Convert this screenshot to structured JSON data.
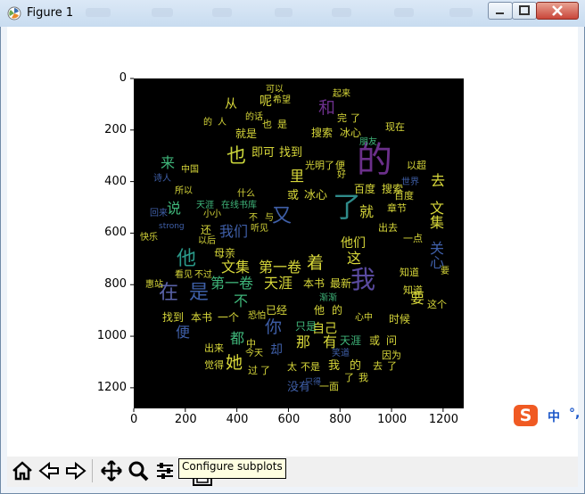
{
  "window": {
    "title": "Figure 1"
  },
  "axes": {
    "y_ticks": [
      "0",
      "200",
      "400",
      "600",
      "800",
      "1000",
      "1200"
    ],
    "x_ticks": [
      "0",
      "200",
      "400",
      "600",
      "800",
      "1000",
      "1200"
    ]
  },
  "toolbar": {
    "tooltip": "Configure subplots"
  },
  "ime": {
    "logo": "S",
    "mode": "中"
  },
  "wordcloud": [
    {
      "t": "的",
      "x": 400,
      "y": 160,
      "s": 40,
      "c": "#6b2f8a"
    },
    {
      "t": "了",
      "x": 373,
      "y": 216,
      "s": 32,
      "c": "#2f8b8a"
    },
    {
      "t": "我",
      "x": 393,
      "y": 300,
      "s": 28,
      "c": "#5a4aa0"
    },
    {
      "t": "也",
      "x": 254,
      "y": 165,
      "s": 22,
      "c": "#c9d43a"
    },
    {
      "t": "又",
      "x": 305,
      "y": 232,
      "s": 22,
      "c": "#3f5fa8"
    },
    {
      "t": "他",
      "x": 198,
      "y": 280,
      "s": 22,
      "c": "#2a9a8a"
    },
    {
      "t": "在",
      "x": 178,
      "y": 318,
      "s": 22,
      "c": "#5a62a8"
    },
    {
      "t": "是",
      "x": 212,
      "y": 318,
      "s": 22,
      "c": "#3e5fa6"
    },
    {
      "t": "着",
      "x": 344,
      "y": 286,
      "s": 19,
      "c": "#d8d83a"
    },
    {
      "t": "你",
      "x": 297,
      "y": 358,
      "s": 19,
      "c": "#3f5fa8"
    },
    {
      "t": "她",
      "x": 253,
      "y": 398,
      "s": 19,
      "c": "#d8d83a"
    },
    {
      "t": "和",
      "x": 357,
      "y": 112,
      "s": 19,
      "c": "#6b2f8a"
    },
    {
      "t": "来",
      "x": 180,
      "y": 175,
      "s": 16,
      "c": "#3fb67a"
    },
    {
      "t": "说",
      "x": 187,
      "y": 226,
      "s": 16,
      "c": "#3fb67a"
    },
    {
      "t": "就",
      "x": 403,
      "y": 230,
      "s": 16,
      "c": "#d8d83a"
    },
    {
      "t": "去",
      "x": 483,
      "y": 195,
      "s": 16,
      "c": "#d8d83a"
    },
    {
      "t": "这",
      "x": 389,
      "y": 282,
      "s": 16,
      "c": "#d8d83a"
    },
    {
      "t": "便",
      "x": 197,
      "y": 365,
      "s": 16,
      "c": "#3f5fa8"
    },
    {
      "t": "有",
      "x": 362,
      "y": 376,
      "s": 16,
      "c": "#d8d83a"
    },
    {
      "t": "那",
      "x": 332,
      "y": 376,
      "s": 16,
      "c": "#d8d83a"
    },
    {
      "t": "都",
      "x": 258,
      "y": 372,
      "s": 16,
      "c": "#3fb67a"
    },
    {
      "t": "里",
      "x": 325,
      "y": 190,
      "s": 16,
      "c": "#d8d83a"
    },
    {
      "t": "不",
      "x": 262,
      "y": 330,
      "s": 16,
      "c": "#3fb67a"
    },
    {
      "t": "要",
      "x": 460,
      "y": 327,
      "s": 16,
      "c": "#d8d83a"
    },
    {
      "t": "却",
      "x": 303,
      "y": 386,
      "s": 14,
      "c": "#3f5fa8"
    },
    {
      "t": "从",
      "x": 252,
      "y": 110,
      "s": 14,
      "c": "#d8d83a"
    },
    {
      "t": "呢",
      "x": 291,
      "y": 107,
      "s": 14,
      "c": "#d8d83a"
    },
    {
      "t": "文集",
      "x": 248,
      "y": 292,
      "s": 16,
      "c": "#d8d83a"
    },
    {
      "t": "第一卷",
      "x": 290,
      "y": 292,
      "s": 16,
      "c": "#d8d83a"
    },
    {
      "t": "第一卷",
      "x": 236,
      "y": 310,
      "s": 16,
      "c": "#3fb67a"
    },
    {
      "t": "天涯",
      "x": 296,
      "y": 310,
      "s": 16,
      "c": "#d8d83a"
    },
    {
      "t": "我们",
      "x": 246,
      "y": 252,
      "s": 16,
      "c": "#3f5fa8"
    },
    {
      "t": "他们",
      "x": 382,
      "y": 266,
      "s": 14,
      "c": "#d8d83a"
    },
    {
      "t": "关心",
      "x": 480,
      "y": 270,
      "s": 16,
      "c": "#3f5fa8",
      "v": 1
    },
    {
      "t": "文集",
      "x": 480,
      "y": 225,
      "s": 16,
      "c": "#d8d83a",
      "v": 1
    },
    {
      "t": "自己",
      "x": 350,
      "y": 362,
      "s": 14,
      "c": "#d8d83a"
    },
    {
      "t": "即可",
      "x": 282,
      "y": 165,
      "s": 13,
      "c": "#d8d83a"
    },
    {
      "t": "找到",
      "x": 313,
      "y": 165,
      "s": 13,
      "c": "#d8d83a"
    },
    {
      "t": "或",
      "x": 322,
      "y": 213,
      "s": 13,
      "c": "#d8d83a"
    },
    {
      "t": "冰心",
      "x": 341,
      "y": 213,
      "s": 13,
      "c": "#d8d83a"
    },
    {
      "t": "百度",
      "x": 397,
      "y": 206,
      "s": 12,
      "c": "#d8d83a"
    },
    {
      "t": "搜索",
      "x": 428,
      "y": 206,
      "s": 12,
      "c": "#d8d83a"
    },
    {
      "t": "搜索",
      "x": 349,
      "y": 143,
      "s": 12,
      "c": "#d8d83a"
    },
    {
      "t": "冰心",
      "x": 381,
      "y": 143,
      "s": 12,
      "c": "#d8d83a"
    },
    {
      "t": "本书",
      "x": 340,
      "y": 312,
      "s": 12,
      "c": "#d8d83a"
    },
    {
      "t": "最新",
      "x": 370,
      "y": 312,
      "s": 12,
      "c": "#d8d83a"
    },
    {
      "t": "找到",
      "x": 182,
      "y": 350,
      "s": 12,
      "c": "#d8d83a"
    },
    {
      "t": "本书",
      "x": 214,
      "y": 350,
      "s": 12,
      "c": "#d8d83a"
    },
    {
      "t": "一个",
      "x": 244,
      "y": 350,
      "s": 12,
      "c": "#d8d83a"
    },
    {
      "t": "母亲",
      "x": 240,
      "y": 278,
      "s": 12,
      "c": "#d8d83a"
    },
    {
      "t": "已经",
      "x": 298,
      "y": 342,
      "s": 12,
      "c": "#d8d83a"
    },
    {
      "t": "只是",
      "x": 331,
      "y": 360,
      "s": 12,
      "c": "#3fb67a"
    },
    {
      "t": "他",
      "x": 352,
      "y": 342,
      "s": 12,
      "c": "#d8d83a"
    },
    {
      "t": "的",
      "x": 372,
      "y": 342,
      "s": 12,
      "c": "#d8d83a"
    },
    {
      "t": "时候",
      "x": 436,
      "y": 352,
      "s": 12,
      "c": "#d8d83a"
    },
    {
      "t": "天涯",
      "x": 381,
      "y": 376,
      "s": 12,
      "c": "#3fb67a"
    },
    {
      "t": "或",
      "x": 414,
      "y": 376,
      "s": 12,
      "c": "#d8d83a"
    },
    {
      "t": "问",
      "x": 433,
      "y": 376,
      "s": 12,
      "c": "#d8d83a"
    },
    {
      "t": "我",
      "x": 368,
      "y": 404,
      "s": 13,
      "c": "#d8d83a"
    },
    {
      "t": "的",
      "x": 392,
      "y": 404,
      "s": 13,
      "c": "#d8d83a"
    },
    {
      "t": "出来",
      "x": 229,
      "y": 385,
      "s": 11,
      "c": "#d8d83a"
    },
    {
      "t": "觉得",
      "x": 229,
      "y": 404,
      "s": 11,
      "c": "#d8d83a"
    },
    {
      "t": "中",
      "x": 276,
      "y": 380,
      "s": 11,
      "c": "#d8d83a"
    },
    {
      "t": "没有",
      "x": 322,
      "y": 428,
      "s": 13,
      "c": "#3f5fa8"
    },
    {
      "t": "一面",
      "x": 358,
      "y": 428,
      "s": 11,
      "c": "#d8d83a"
    },
    {
      "t": "了",
      "x": 386,
      "y": 418,
      "s": 11,
      "c": "#d8d83a"
    },
    {
      "t": "我",
      "x": 402,
      "y": 418,
      "s": 11,
      "c": "#d8d83a"
    },
    {
      "t": "去",
      "x": 418,
      "y": 405,
      "s": 11,
      "c": "#d8d83a"
    },
    {
      "t": "了",
      "x": 434,
      "y": 405,
      "s": 11,
      "c": "#d8d83a"
    },
    {
      "t": "太",
      "x": 322,
      "y": 406,
      "s": 11,
      "c": "#d8d83a"
    },
    {
      "t": "不是",
      "x": 337,
      "y": 406,
      "s": 11,
      "c": "#d8d83a"
    },
    {
      "t": "过",
      "x": 278,
      "y": 410,
      "s": 11,
      "c": "#d8d83a"
    },
    {
      "t": "了",
      "x": 292,
      "y": 410,
      "s": 11,
      "c": "#d8d83a"
    },
    {
      "t": "就是",
      "x": 264,
      "y": 144,
      "s": 12,
      "c": "#d8d83a"
    },
    {
      "t": "也",
      "x": 294,
      "y": 134,
      "s": 11,
      "c": "#d8d83a"
    },
    {
      "t": "是",
      "x": 311,
      "y": 134,
      "s": 11,
      "c": "#d8d83a"
    },
    {
      "t": "光明",
      "x": 342,
      "y": 180,
      "s": 11,
      "c": "#d8d83a"
    },
    {
      "t": "了",
      "x": 364,
      "y": 180,
      "s": 11,
      "c": "#d8d83a"
    },
    {
      "t": "便",
      "x": 376,
      "y": 180,
      "s": 11,
      "c": "#d8d83a"
    },
    {
      "t": "完",
      "x": 378,
      "y": 127,
      "s": 11,
      "c": "#d8d83a"
    },
    {
      "t": "了",
      "x": 393,
      "y": 127,
      "s": 11,
      "c": "#d8d83a"
    },
    {
      "t": "现在",
      "x": 432,
      "y": 137,
      "s": 11,
      "c": "#d8d83a"
    },
    {
      "t": "以超",
      "x": 456,
      "y": 180,
      "s": 11,
      "c": "#d8d83a"
    },
    {
      "t": "章节",
      "x": 434,
      "y": 228,
      "s": 11,
      "c": "#d8d83a"
    },
    {
      "t": "百度",
      "x": 442,
      "y": 214,
      "s": 11,
      "c": "#d8d83a"
    },
    {
      "t": "知道",
      "x": 448,
      "y": 300,
      "s": 11,
      "c": "#d8d83a"
    },
    {
      "t": "知道",
      "x": 452,
      "y": 320,
      "s": 11,
      "c": "#d8d83a"
    },
    {
      "t": "这个",
      "x": 479,
      "y": 336,
      "s": 11,
      "c": "#d8d83a"
    },
    {
      "t": "因为",
      "x": 428,
      "y": 393,
      "s": 11,
      "c": "#d8d83a"
    },
    {
      "t": "出去",
      "x": 424,
      "y": 250,
      "s": 11,
      "c": "#d8d83a"
    },
    {
      "t": "一点",
      "x": 452,
      "y": 262,
      "s": 11,
      "c": "#d8d83a"
    },
    {
      "t": "小小",
      "x": 228,
      "y": 236,
      "s": 10,
      "c": "#d8d83a"
    },
    {
      "t": "在线书库",
      "x": 248,
      "y": 226,
      "s": 10,
      "c": "#3fb67a"
    },
    {
      "t": "天涯",
      "x": 220,
      "y": 226,
      "s": 10,
      "c": "#3fb67a"
    },
    {
      "t": "什么",
      "x": 266,
      "y": 213,
      "s": 10,
      "c": "#d8d83a"
    },
    {
      "t": "还",
      "x": 225,
      "y": 252,
      "s": 12,
      "c": "#d8d83a"
    },
    {
      "t": "可以",
      "x": 298,
      "y": 96,
      "s": 10,
      "c": "#d8d83a"
    },
    {
      "t": "起来",
      "x": 373,
      "y": 101,
      "s": 10,
      "c": "#d8d83a"
    },
    {
      "t": "希望",
      "x": 306,
      "y": 108,
      "s": 10,
      "c": "#d8d83a"
    },
    {
      "t": "的话",
      "x": 275,
      "y": 127,
      "s": 10,
      "c": "#d8d83a"
    },
    {
      "t": "的",
      "x": 228,
      "y": 133,
      "s": 10,
      "c": "#d8d83a"
    },
    {
      "t": "人",
      "x": 244,
      "y": 133,
      "s": 10,
      "c": "#d8d83a"
    },
    {
      "t": "快乐",
      "x": 157,
      "y": 262,
      "s": 10,
      "c": "#d8d83a"
    },
    {
      "t": "诗人",
      "x": 172,
      "y": 196,
      "s": 10,
      "c": "#3f5fa8"
    },
    {
      "t": "中国",
      "x": 203,
      "y": 186,
      "s": 10,
      "c": "#d8d83a"
    },
    {
      "t": "所以",
      "x": 196,
      "y": 210,
      "s": 10,
      "c": "#d8d83a"
    },
    {
      "t": "回来",
      "x": 168,
      "y": 235,
      "s": 10,
      "c": "#3f5fa8"
    },
    {
      "t": "strong",
      "x": 178,
      "y": 250,
      "s": 9,
      "c": "#3f5fa8"
    },
    {
      "t": "以后",
      "x": 222,
      "y": 266,
      "s": 10,
      "c": "#d8d83a"
    },
    {
      "t": "看见",
      "x": 196,
      "y": 304,
      "s": 10,
      "c": "#d8d83a"
    },
    {
      "t": "不过",
      "x": 218,
      "y": 304,
      "s": 10,
      "c": "#d8d83a"
    },
    {
      "t": "惠站",
      "x": 163,
      "y": 315,
      "s": 10,
      "c": "#d8d83a"
    },
    {
      "t": "听见",
      "x": 281,
      "y": 252,
      "s": 10,
      "c": "#d8d83a"
    },
    {
      "t": "恐怕",
      "x": 278,
      "y": 350,
      "s": 10,
      "c": "#d8d83a"
    },
    {
      "t": "渐渐",
      "x": 358,
      "y": 330,
      "s": 10,
      "c": "#3fb67a"
    },
    {
      "t": "今天",
      "x": 275,
      "y": 392,
      "s": 10,
      "c": "#d8d83a"
    },
    {
      "t": "只得",
      "x": 342,
      "y": 425,
      "s": 9,
      "c": "#3f5fa8"
    },
    {
      "t": "笑道",
      "x": 372,
      "y": 392,
      "s": 10,
      "c": "#3f5fa8"
    },
    {
      "t": "世界",
      "x": 450,
      "y": 200,
      "s": 10,
      "c": "#3f5fa8"
    },
    {
      "t": "朋友",
      "x": 403,
      "y": 155,
      "s": 10,
      "c": "#3fb67a"
    },
    {
      "t": "要",
      "x": 494,
      "y": 300,
      "s": 10,
      "c": "#d8d83a"
    },
    {
      "t": "好",
      "x": 378,
      "y": 192,
      "s": 10,
      "c": "#d8d83a"
    },
    {
      "t": "与",
      "x": 297,
      "y": 240,
      "s": 10,
      "c": "#d8d83a"
    },
    {
      "t": "不",
      "x": 279,
      "y": 240,
      "s": 10,
      "c": "#d8d83a"
    },
    {
      "t": "心中",
      "x": 398,
      "y": 352,
      "s": 10,
      "c": "#d8d83a"
    }
  ]
}
